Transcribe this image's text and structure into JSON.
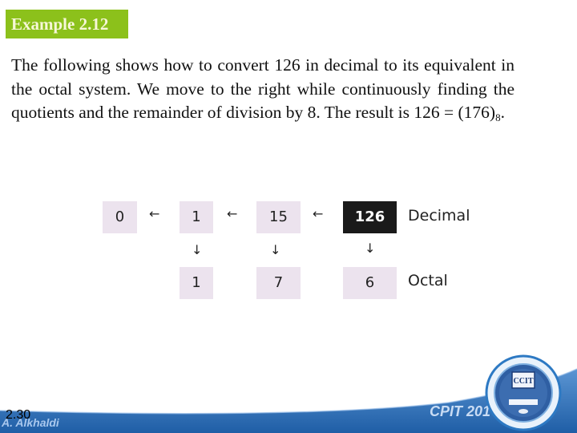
{
  "slide": {
    "title": "Example 2.12",
    "paragraph_main": "The following shows how to convert 126 in decimal to its equivalent in the octal system. We move to the right while continuously finding the quotients and the remainder of division by 8. The result is 126 = (176)",
    "paragraph_subscript": "8",
    "paragraph_end": "."
  },
  "diagram": {
    "decimal_row": [
      "0",
      "1",
      "15",
      "126"
    ],
    "octal_row": [
      "1",
      "7",
      "6"
    ],
    "left_arrow": "←",
    "down_arrow": "↓",
    "decimal_label": "Decimal",
    "octal_label": "Octal"
  },
  "footer": {
    "slide_number": "2.30",
    "author": "A. Alkhaldi",
    "course": "CPIT 201",
    "logo_text": "CCIT"
  },
  "colors": {
    "title_badge": "#8cc11b",
    "box_fill": "#ece3ee",
    "box_highlight": "#1a1a1a",
    "footer_blue": "#2f6fb5"
  }
}
